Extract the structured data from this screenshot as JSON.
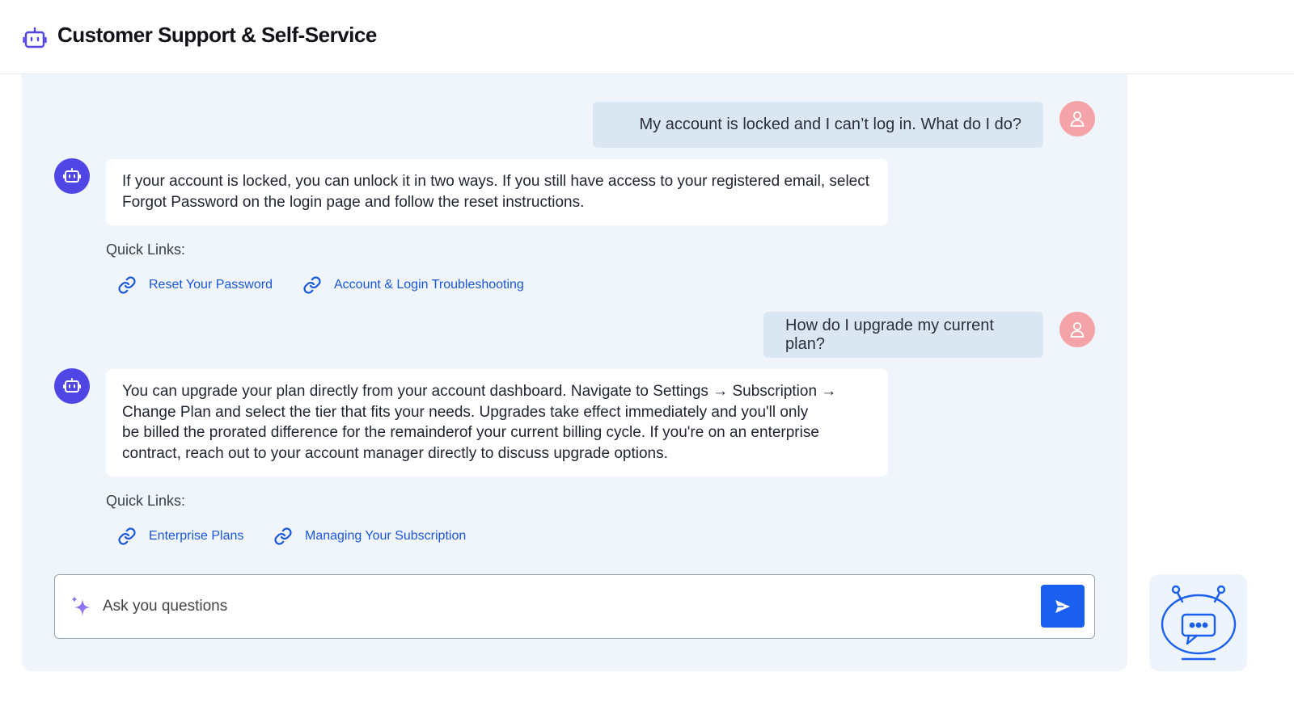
{
  "header": {
    "title": "Customer Support & Self-Service",
    "logo_icon": "robot-icon"
  },
  "conversation": {
    "messages": [
      {
        "role": "user",
        "text": "My account is locked and I can’t log in. What do I do?"
      },
      {
        "role": "bot",
        "lines": [
          "If your account is locked, you can unlock it in two ways. If you still have access to your registered email, select",
          "Forgot Password on the login page and follow the reset instructions."
        ],
        "quick_links_label": "Quick Links:",
        "links": [
          "Reset Your Password",
          "Account & Login Troubleshooting"
        ]
      },
      {
        "role": "user",
        "text": "How do I upgrade my current plan?"
      },
      {
        "role": "bot",
        "lines": [
          "You can upgrade your plan directly from your account dashboard. Navigate to Settings → Subscription →",
          "Change Plan and select the tier that fits your needs. Upgrades take effect immediately and you'll only",
          "be billed the prorated difference for the remainderof your current billing cycle. If you're on an enterprise",
          "contract, reach out to your account manager directly to discuss upgrade options."
        ],
        "quick_links_label": "Quick Links:",
        "links": [
          "Enterprise Plans",
          "Managing Your Subscription"
        ]
      }
    ]
  },
  "composer": {
    "placeholder": "Ask you questions",
    "value": "",
    "sparkle_icon": "sparkle-icon",
    "send_icon": "send-icon"
  },
  "widget": {
    "icon": "chatbot-icon"
  },
  "colors": {
    "accent": "#1a5ff0",
    "bot_avatar": "#4f46e5",
    "user_avatar": "#f4a3a8",
    "panel_bg": "#f0f5fb",
    "user_bubble": "#dbe6f3",
    "link": "#1a56db"
  }
}
